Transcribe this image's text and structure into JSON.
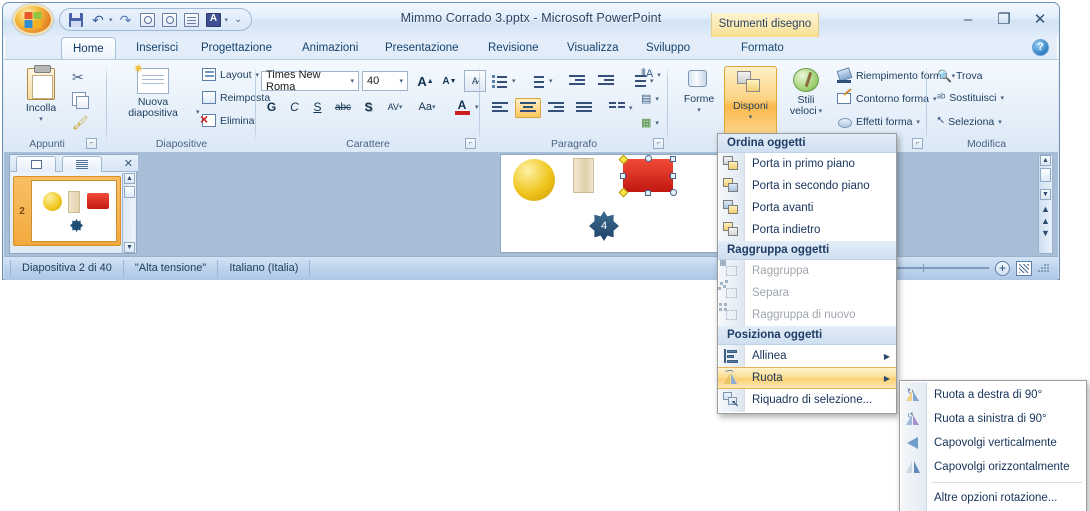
{
  "window": {
    "title": "Mimmo Corrado 3.pptx - Microsoft PowerPoint",
    "contextual_tab_group": "Strumenti disegno",
    "controls": {
      "minimize": "–",
      "restore": "❐",
      "close": "✕"
    },
    "help_label": "?"
  },
  "quick_access": {
    "items": [
      {
        "name": "save-icon",
        "tooltip": "Salva"
      },
      {
        "name": "undo-icon",
        "tooltip": "Annulla",
        "glyph": "↶"
      },
      {
        "name": "redo-icon",
        "tooltip": "Ripeti",
        "glyph": "↷"
      },
      {
        "name": "print-preview-icon",
        "tooltip": "Anteprima"
      },
      {
        "name": "spell-check-icon",
        "tooltip": "Controllo ortografia"
      },
      {
        "name": "text-box-icon",
        "tooltip": "Casella di testo"
      },
      {
        "name": "font-color-icon",
        "tooltip": "Colore carattere",
        "glyph": "A"
      }
    ],
    "more_glyph": "⌄"
  },
  "tabs": [
    {
      "label": "Home",
      "active": true
    },
    {
      "label": "Inserisci",
      "active": false
    },
    {
      "label": "Progettazione",
      "active": false
    },
    {
      "label": "Animazioni",
      "active": false
    },
    {
      "label": "Presentazione",
      "active": false
    },
    {
      "label": "Revisione",
      "active": false
    },
    {
      "label": "Visualizza",
      "active": false
    },
    {
      "label": "Sviluppo",
      "active": false
    },
    {
      "label": "Formato",
      "active": false,
      "contextual": true
    }
  ],
  "ribbon": {
    "groups": [
      {
        "name": "appunti",
        "label": "Appunti"
      },
      {
        "name": "diapositive",
        "label": "Diapositive"
      },
      {
        "name": "carattere",
        "label": "Carattere"
      },
      {
        "name": "paragrafo",
        "label": "Paragrafo"
      },
      {
        "name": "disegno",
        "label": ""
      },
      {
        "name": "modifica",
        "label": "Modifica"
      }
    ],
    "clipboard": {
      "paste": "Incolla",
      "cut_tooltip": "Taglia",
      "copy_tooltip": "Copia",
      "format_painter_tooltip": "Copia formato"
    },
    "slides": {
      "new_slide_line1": "Nuova",
      "new_slide_line2": "diapositiva",
      "layout": "Layout",
      "reset": "Reimposta",
      "delete": "Elimina"
    },
    "font": {
      "font_name": "Times New Roma",
      "font_size": "40",
      "grow_label": "A",
      "shrink_label": "A",
      "clear_formatting_tooltip": "Cancella formattazione",
      "bold": "G",
      "italic": "C",
      "underline": "S",
      "strikethrough": "abc",
      "shadow": "S",
      "spacing": "AV",
      "change_case": "Aa",
      "font_color": "A"
    },
    "drawing": {
      "shapes": "Forme",
      "arrange": "Disponi",
      "quick_styles_line1": "Stili",
      "quick_styles_line2": "veloci",
      "shape_fill": "Riempimento forma",
      "shape_outline": "Contorno forma",
      "shape_effects": "Effetti forma"
    },
    "editing": {
      "find": "Trova",
      "replace": "Sostituisci",
      "select": "Seleziona"
    }
  },
  "thumbnail_pane": {
    "tab_slides_tooltip": "Diapositive",
    "tab_outline_tooltip": "Struttura",
    "close_glyph": "✕",
    "slide_number": "2"
  },
  "slide": {
    "star_label": "4"
  },
  "menu": {
    "sections": [
      {
        "header": "Ordina oggetti",
        "items": [
          {
            "label": "Porta in primo piano",
            "icon": "bring-to-front-icon",
            "disabled": false,
            "submenu": false
          },
          {
            "label": "Porta in secondo piano",
            "icon": "send-to-back-icon",
            "disabled": false,
            "submenu": false
          },
          {
            "label": "Porta avanti",
            "icon": "bring-forward-icon",
            "disabled": false,
            "submenu": false
          },
          {
            "label": "Porta indietro",
            "icon": "send-backward-icon",
            "disabled": false,
            "submenu": false
          }
        ]
      },
      {
        "header": "Raggruppa oggetti",
        "items": [
          {
            "label": "Raggruppa",
            "icon": "group-icon",
            "disabled": true,
            "submenu": false
          },
          {
            "label": "Separa",
            "icon": "ungroup-icon",
            "disabled": true,
            "submenu": false
          },
          {
            "label": "Raggruppa di nuovo",
            "icon": "regroup-icon",
            "disabled": true,
            "submenu": false
          }
        ]
      },
      {
        "header": "Posiziona oggetti",
        "items": [
          {
            "label": "Allinea",
            "icon": "align-icon",
            "disabled": false,
            "submenu": true,
            "highlighted": false
          },
          {
            "label": "Ruota",
            "icon": "rotate-icon",
            "disabled": false,
            "submenu": true,
            "highlighted": true
          },
          {
            "label": "Riquadro di selezione...",
            "icon": "selection-pane-icon",
            "disabled": false,
            "submenu": false
          }
        ]
      }
    ],
    "submenu_arrow": "▶"
  },
  "submenu": {
    "items": [
      {
        "label": "Ruota a destra di 90°",
        "icon": "rotate-right-icon"
      },
      {
        "label": "Ruota a sinistra di 90°",
        "icon": "rotate-left-icon"
      },
      {
        "label": "Capovolgi verticalmente",
        "icon": "flip-vertical-icon"
      },
      {
        "label": "Capovolgi orizzontalmente",
        "icon": "flip-horizontal-icon"
      }
    ],
    "more_options": "Altre opzioni rotazione..."
  },
  "status_bar": {
    "slide_indicator": "Diapositiva 2 di 40",
    "theme_name": "\"Alta tensione\"",
    "language": "Italiano (Italia)",
    "zoom_in_glyph": "+",
    "fit_to_window_tooltip": "Adatta diapositiva alla finestra corrente"
  },
  "colors": {
    "accent_orange": "#fbd072",
    "ribbon_blue": "#dbe8f6",
    "menu_header_blue": "#cfdff1",
    "selected_shape_red": "#c0170f"
  }
}
